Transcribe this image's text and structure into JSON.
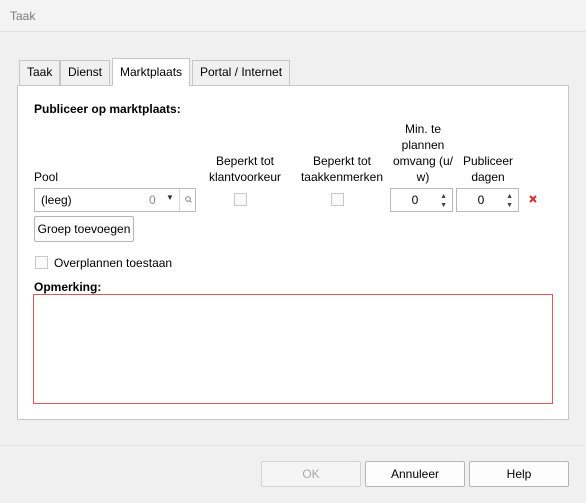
{
  "window": {
    "title": "Taak"
  },
  "tabs": [
    {
      "label": "Taak"
    },
    {
      "label": "Dienst"
    },
    {
      "label": "Marktplaats"
    },
    {
      "label": "Portal / Internet"
    }
  ],
  "marketplace": {
    "section_title": "Publiceer op marktplaats:",
    "columns": {
      "pool": "Pool",
      "beperkt_klant": [
        "Beperkt tot",
        "klantvoorkeur"
      ],
      "beperkt_taak": [
        "Beperkt tot",
        "taakkenmerken"
      ],
      "min_plannen": [
        "Min. te",
        "plannen",
        "omvang (u/",
        "w)"
      ],
      "publiceer": [
        "Publiceer",
        "dagen"
      ]
    },
    "pool_value": "(leeg)",
    "pool_count": "0",
    "min_plannen_value": "0",
    "publiceer_value": "0",
    "add_group_label": "Groep toevoegen",
    "allow_overplan_label": "Overplannen toestaan",
    "allow_overplan_checked": false,
    "remark_label": "Opmerking:",
    "remark_value": ""
  },
  "footer": {
    "ok_label": "OK",
    "cancel_label": "Annuleer",
    "help_label": "Help"
  },
  "colors": {
    "remove_icon": "#d32f2f",
    "remark_border": "#e25858"
  },
  "icons": {
    "remove": "x-icon",
    "lookup": "search-icon",
    "dropdown": "chevron-down-icon"
  }
}
